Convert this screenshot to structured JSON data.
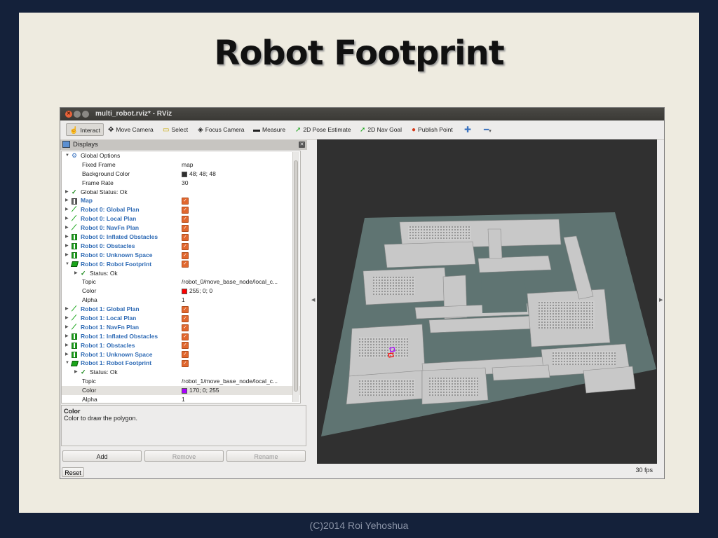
{
  "slide": {
    "title": "Robot Footprint",
    "footer": "(C)2014 Roi Yehoshua"
  },
  "window": {
    "title": "multi_robot.rviz* - RViz"
  },
  "toolbar": {
    "interact": "Interact",
    "move_camera": "Move Camera",
    "select": "Select",
    "focus_camera": "Focus Camera",
    "measure": "Measure",
    "pose_estimate": "2D Pose Estimate",
    "nav_goal": "2D Nav Goal",
    "publish_point": "Publish Point"
  },
  "displays": {
    "header": "Displays",
    "rows": [
      {
        "indent": 0,
        "arrow": "▼",
        "icon": "options",
        "name": "Global Options",
        "blue": false,
        "value": ""
      },
      {
        "indent": 2,
        "arrow": "",
        "icon": "",
        "name": "Fixed Frame",
        "blue": false,
        "value": "map"
      },
      {
        "indent": 2,
        "arrow": "",
        "icon": "",
        "name": "Background Color",
        "blue": false,
        "value": "48; 48; 48",
        "swatch": "#303030"
      },
      {
        "indent": 2,
        "arrow": "",
        "icon": "",
        "name": "Frame Rate",
        "blue": false,
        "value": "30"
      },
      {
        "indent": 0,
        "arrow": "▶",
        "icon": "tick",
        "name": "Global Status: Ok",
        "blue": false,
        "value": ""
      },
      {
        "indent": 0,
        "arrow": "▶",
        "icon": "map",
        "name": "Map",
        "blue": true,
        "check": true
      },
      {
        "indent": 0,
        "arrow": "▶",
        "icon": "plan",
        "name": "Robot 0: Global Plan",
        "blue": true,
        "check": true
      },
      {
        "indent": 0,
        "arrow": "▶",
        "icon": "plan",
        "name": "Robot 0: Local Plan",
        "blue": true,
        "check": true
      },
      {
        "indent": 0,
        "arrow": "▶",
        "icon": "plan",
        "name": "Robot 0: NavFn Plan",
        "blue": true,
        "check": true
      },
      {
        "indent": 0,
        "arrow": "▶",
        "icon": "grid",
        "name": "Robot 0: Inflated Obstacles",
        "blue": true,
        "check": true
      },
      {
        "indent": 0,
        "arrow": "▶",
        "icon": "grid",
        "name": "Robot 0: Obstacles",
        "blue": true,
        "check": true
      },
      {
        "indent": 0,
        "arrow": "▶",
        "icon": "grid",
        "name": "Robot 0: Unknown Space",
        "blue": true,
        "check": true
      },
      {
        "indent": 0,
        "arrow": "▼",
        "icon": "foot",
        "name": "Robot 0: Robot Footprint",
        "blue": true,
        "check": true
      },
      {
        "indent": 1,
        "arrow": "▶",
        "icon": "tick",
        "name": "Status: Ok",
        "blue": false,
        "value": ""
      },
      {
        "indent": 2,
        "arrow": "",
        "icon": "",
        "name": "Topic",
        "blue": false,
        "value": "/robot_0/move_base_node/local_c..."
      },
      {
        "indent": 2,
        "arrow": "",
        "icon": "",
        "name": "Color",
        "blue": false,
        "value": "255; 0; 0",
        "swatch": "#ff0000"
      },
      {
        "indent": 2,
        "arrow": "",
        "icon": "",
        "name": "Alpha",
        "blue": false,
        "value": "1"
      },
      {
        "indent": 0,
        "arrow": "▶",
        "icon": "plan",
        "name": "Robot 1: Global Plan",
        "blue": true,
        "check": true
      },
      {
        "indent": 0,
        "arrow": "▶",
        "icon": "plan",
        "name": "Robot 1: Local Plan",
        "blue": true,
        "check": true
      },
      {
        "indent": 0,
        "arrow": "▶",
        "icon": "plan",
        "name": "Robot 1: NavFn Plan",
        "blue": true,
        "check": true
      },
      {
        "indent": 0,
        "arrow": "▶",
        "icon": "grid",
        "name": "Robot 1: Inflated Obstacles",
        "blue": true,
        "check": true
      },
      {
        "indent": 0,
        "arrow": "▶",
        "icon": "grid",
        "name": "Robot 1: Obstacles",
        "blue": true,
        "check": true
      },
      {
        "indent": 0,
        "arrow": "▶",
        "icon": "grid",
        "name": "Robot 1: Unknown Space",
        "blue": true,
        "check": true
      },
      {
        "indent": 0,
        "arrow": "▼",
        "icon": "foot",
        "name": "Robot 1: Robot Footprint",
        "blue": true,
        "check": true
      },
      {
        "indent": 1,
        "arrow": "▶",
        "icon": "tick",
        "name": "Status: Ok",
        "blue": false,
        "value": ""
      },
      {
        "indent": 2,
        "arrow": "",
        "icon": "",
        "name": "Topic",
        "blue": false,
        "value": "/robot_1/move_base_node/local_c..."
      },
      {
        "indent": 2,
        "arrow": "",
        "icon": "",
        "name": "Color",
        "blue": false,
        "value": "170; 0; 255",
        "swatch": "#aa00ff",
        "selected": true
      },
      {
        "indent": 2,
        "arrow": "",
        "icon": "",
        "name": "Alpha",
        "blue": false,
        "value": "1"
      }
    ]
  },
  "description": {
    "title": "Color",
    "text": "Color to draw the polygon."
  },
  "buttons": {
    "add": "Add",
    "remove": "Remove",
    "rename": "Rename"
  },
  "status": {
    "reset": "Reset",
    "fps": "30 fps"
  }
}
